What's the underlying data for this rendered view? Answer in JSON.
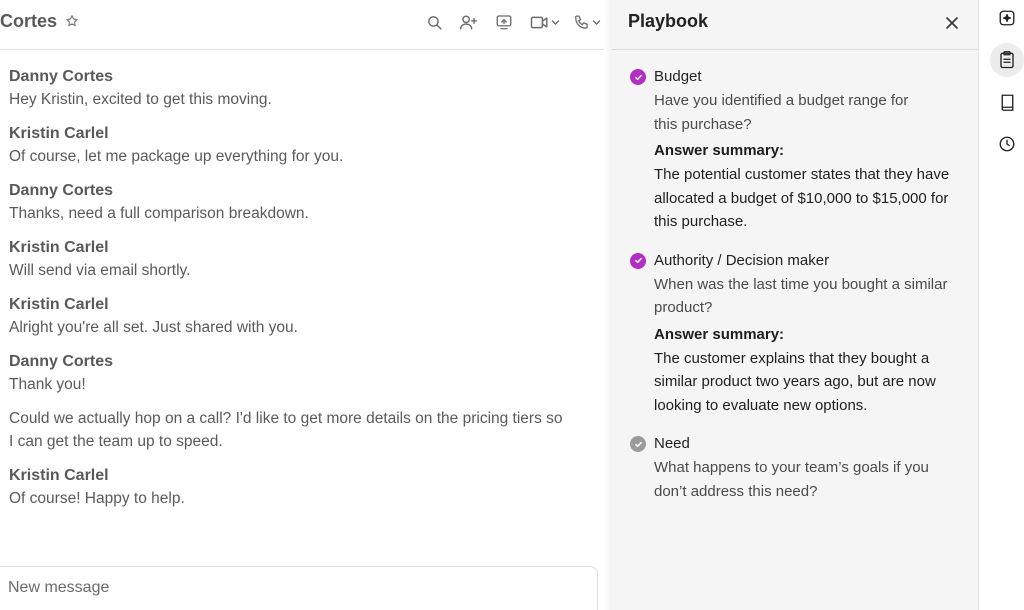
{
  "header": {
    "title": "Cortes",
    "icons": [
      "star-icon",
      "search-icon",
      "add-user-icon",
      "share-screen-icon",
      "video-icon",
      "phone-icon"
    ]
  },
  "messages": [
    {
      "author": "Danny Cortes",
      "lines": [
        "Hey Kristin, excited to get this moving."
      ]
    },
    {
      "author": "Kristin Carlel",
      "lines": [
        "Of course, let me package up everything for you."
      ]
    },
    {
      "author": "Danny Cortes",
      "lines": [
        "Thanks, need a full comparison breakdown."
      ]
    },
    {
      "author": "Kristin Carlel",
      "lines": [
        "Will send via email shortly."
      ]
    },
    {
      "author": "Kristin Carlel",
      "lines": [
        "Alright you're all set. Just shared with you."
      ]
    },
    {
      "author": "Danny Cortes",
      "lines": [
        "Thank you!",
        "Could we actually hop on a call? I'd like to get more details on the pricing tiers so I can get the team up to speed."
      ]
    },
    {
      "author": "Kristin Carlel",
      "lines": [
        "Of course! Happy to help."
      ]
    }
  ],
  "composer": {
    "placeholder": "New message"
  },
  "playbook": {
    "title": "Playbook",
    "items": [
      {
        "status": "done",
        "name": "Budget",
        "question": "Have you identified a budget range for this purchase?",
        "summary_label": "Answer summary:",
        "summary": "The potential customer states that they have allocated a budget of $10,000 to $15,000 for this purchase."
      },
      {
        "status": "done",
        "name": "Authority / Decision maker",
        "question": "When was the last time you bought a similar product?",
        "summary_label": "Answer summary:",
        "summary": "The customer explains that they bought a similar product two years ago, but are now looking to evaluate new options."
      },
      {
        "status": "pending",
        "name": "Need",
        "question": "What happens to your team’s goals if you don’t address this need?"
      }
    ]
  },
  "rail": {
    "icons": [
      "ai-sparkle-icon",
      "clipboard-icon",
      "book-icon",
      "clock-icon"
    ],
    "active": "clipboard-icon"
  },
  "colors": {
    "check_done": "#b12fc4",
    "check_pending": "#9b9b9b"
  }
}
